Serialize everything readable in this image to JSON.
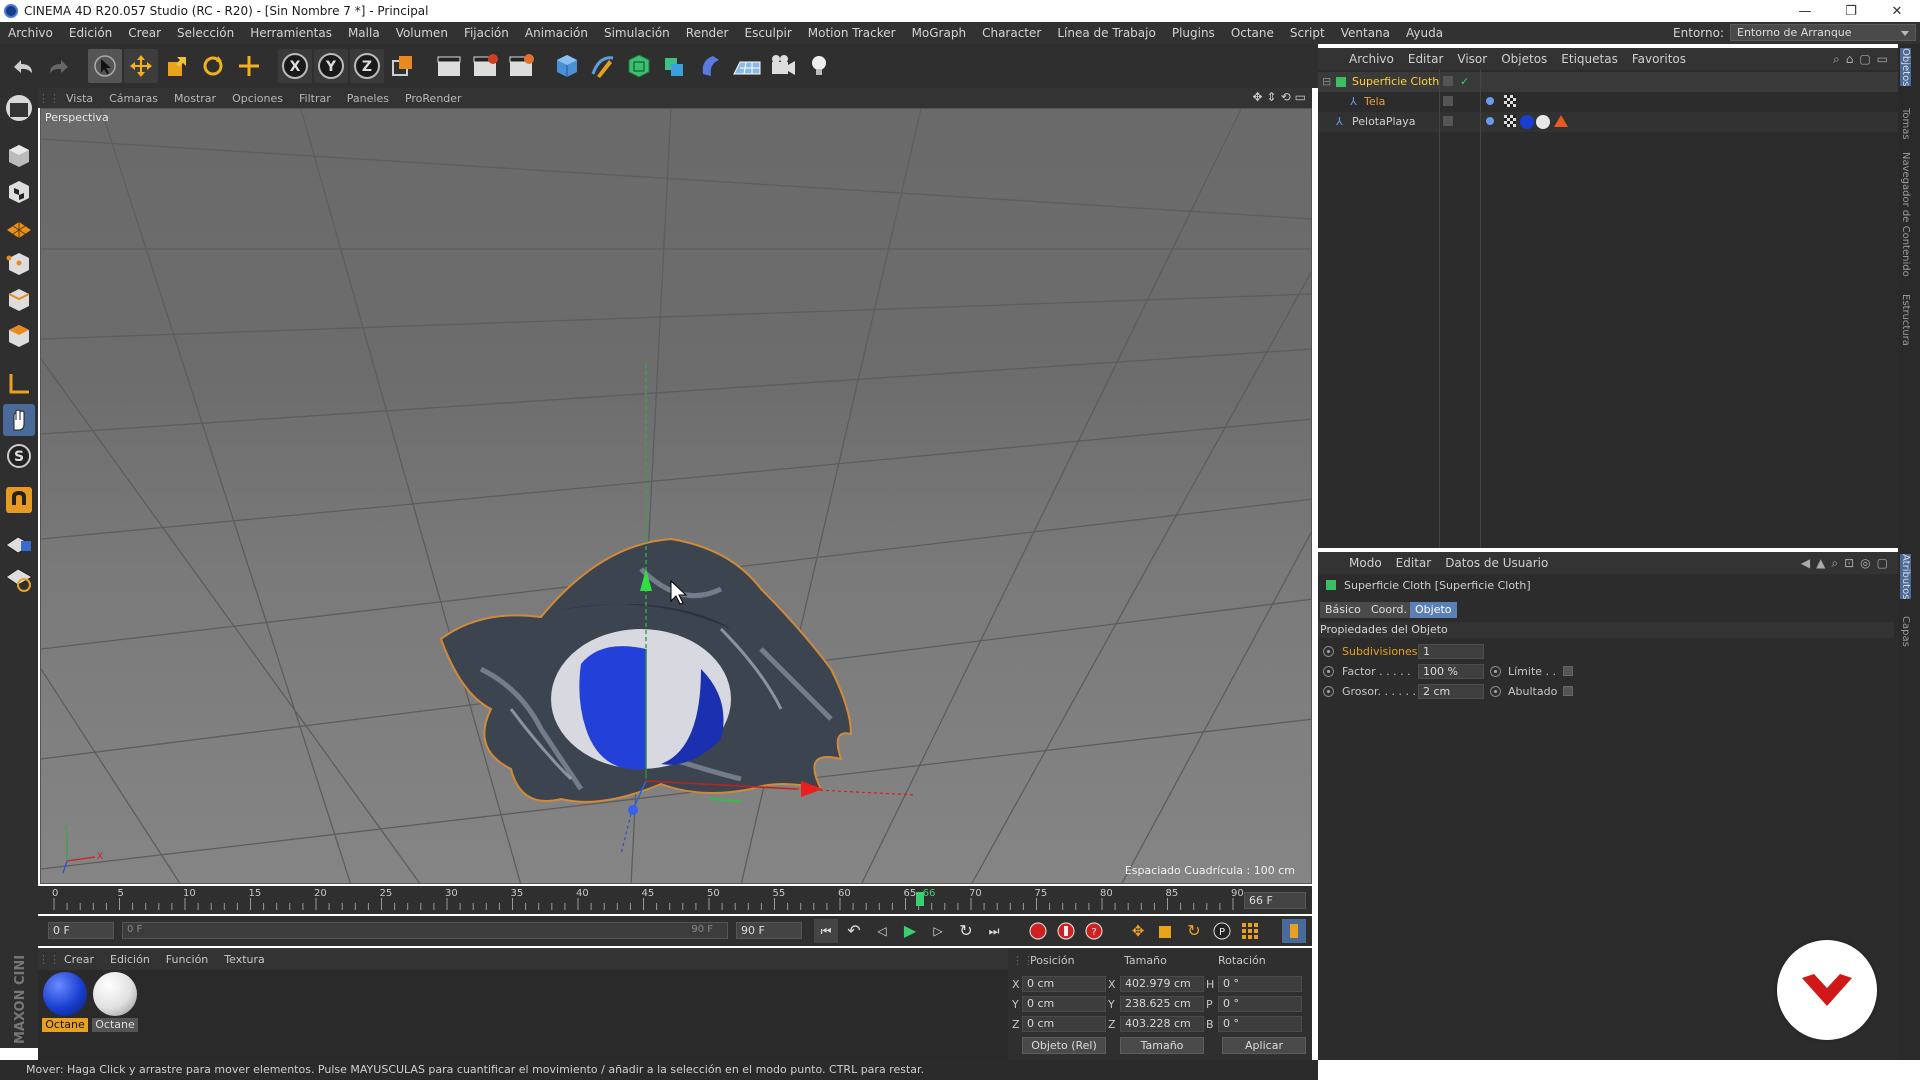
{
  "titlebar": {
    "title": "CINEMA 4D R20.057 Studio (RC - R20) - [Sin Nombre 7 *] - Principal"
  },
  "menubar": {
    "items": [
      "Archivo",
      "Edición",
      "Crear",
      "Selección",
      "Herramientas",
      "Malla",
      "Volumen",
      "Fijación",
      "Animación",
      "Simulación",
      "Render",
      "Esculpir",
      "Motion Tracker",
      "MoGraph",
      "Character",
      "Línea de Trabajo",
      "Plugins",
      "Octane",
      "Script",
      "Ventana",
      "Ayuda"
    ],
    "env_label": "Entorno:",
    "env_value": "Entorno de Arranque"
  },
  "viewport": {
    "menu": [
      "Vista",
      "Cámaras",
      "Mostrar",
      "Opciones",
      "Filtrar",
      "Paneles",
      "ProRender"
    ],
    "name": "Perspectiva",
    "grid_spacing": "Espaciado Cuadrícula : 100 cm"
  },
  "timeline": {
    "ticks": [
      "0",
      "5",
      "10",
      "15",
      "20",
      "25",
      "30",
      "35",
      "40",
      "45",
      "50",
      "55",
      "60",
      "65",
      "66",
      "70",
      "75",
      "80",
      "85",
      "90"
    ],
    "current_frame_field": "66 F",
    "start_field": "0 F",
    "range_start": "0 F",
    "range_end": "90 F",
    "end_field": "90 F"
  },
  "materials": {
    "menu": [
      "Crear",
      "Edición",
      "Función",
      "Textura"
    ],
    "items": [
      {
        "name": "Octane",
        "color": "#1a3fd0"
      },
      {
        "name": "Octane",
        "color": "#e8e8e8"
      }
    ]
  },
  "brand_vertical": "MAXON CINEMA 4D",
  "coordinates": {
    "headers": {
      "position": "Posición",
      "size": "Tamaño",
      "rotation": "Rotación"
    },
    "axes_pos": [
      "X",
      "Y",
      "Z"
    ],
    "axes_rot": [
      "H",
      "P",
      "B"
    ],
    "pos": [
      "0 cm",
      "0 cm",
      "0 cm"
    ],
    "size": [
      "402.979 cm",
      "238.625 cm",
      "403.228 cm"
    ],
    "rot": [
      "0 °",
      "0 °",
      "0 °"
    ],
    "mode_dropdown": "Objeto (Rel)",
    "size_dropdown": "Tamaño",
    "apply_label": "Aplicar"
  },
  "status": {
    "text": "Mover: Haga Click y arrastre para mover elementos. Pulse MAYUSCULAS para cuantificar el movimiento / añadir a la selección en el modo punto. CTRL para restar."
  },
  "objects": {
    "menu": [
      "Archivo",
      "Editar",
      "Visor",
      "Objetos",
      "Etiquetas",
      "Favoritos"
    ],
    "rows": [
      {
        "name": "Superficie Cloth",
        "color": "#ffd23a"
      },
      {
        "name": "Tela",
        "color": "#e0a040"
      },
      {
        "name": "PelotaPlaya",
        "color": "#d0d0d0"
      }
    ]
  },
  "right_strip": [
    "Objetos",
    "Tomas",
    "Navegador de Contenido",
    "Estructura",
    "Atributos",
    "Capas"
  ],
  "attributes": {
    "menu": [
      "Modo",
      "Editar",
      "Datos de Usuario"
    ],
    "object_title": "Superficie Cloth [Superficie Cloth]",
    "tabs": [
      "Básico",
      "Coord.",
      "Objeto"
    ],
    "section": "Propiedades del Objeto",
    "subdivisions_label": "Subdivisiones",
    "subdivisions_value": "1",
    "factor_label": "Factor . . . . .",
    "factor_value": "100 %",
    "grosor_label": "Grosor. . . . . .",
    "grosor_value": "2 cm",
    "limite_label": "Límite . .",
    "abultado_label": "Abultado"
  }
}
